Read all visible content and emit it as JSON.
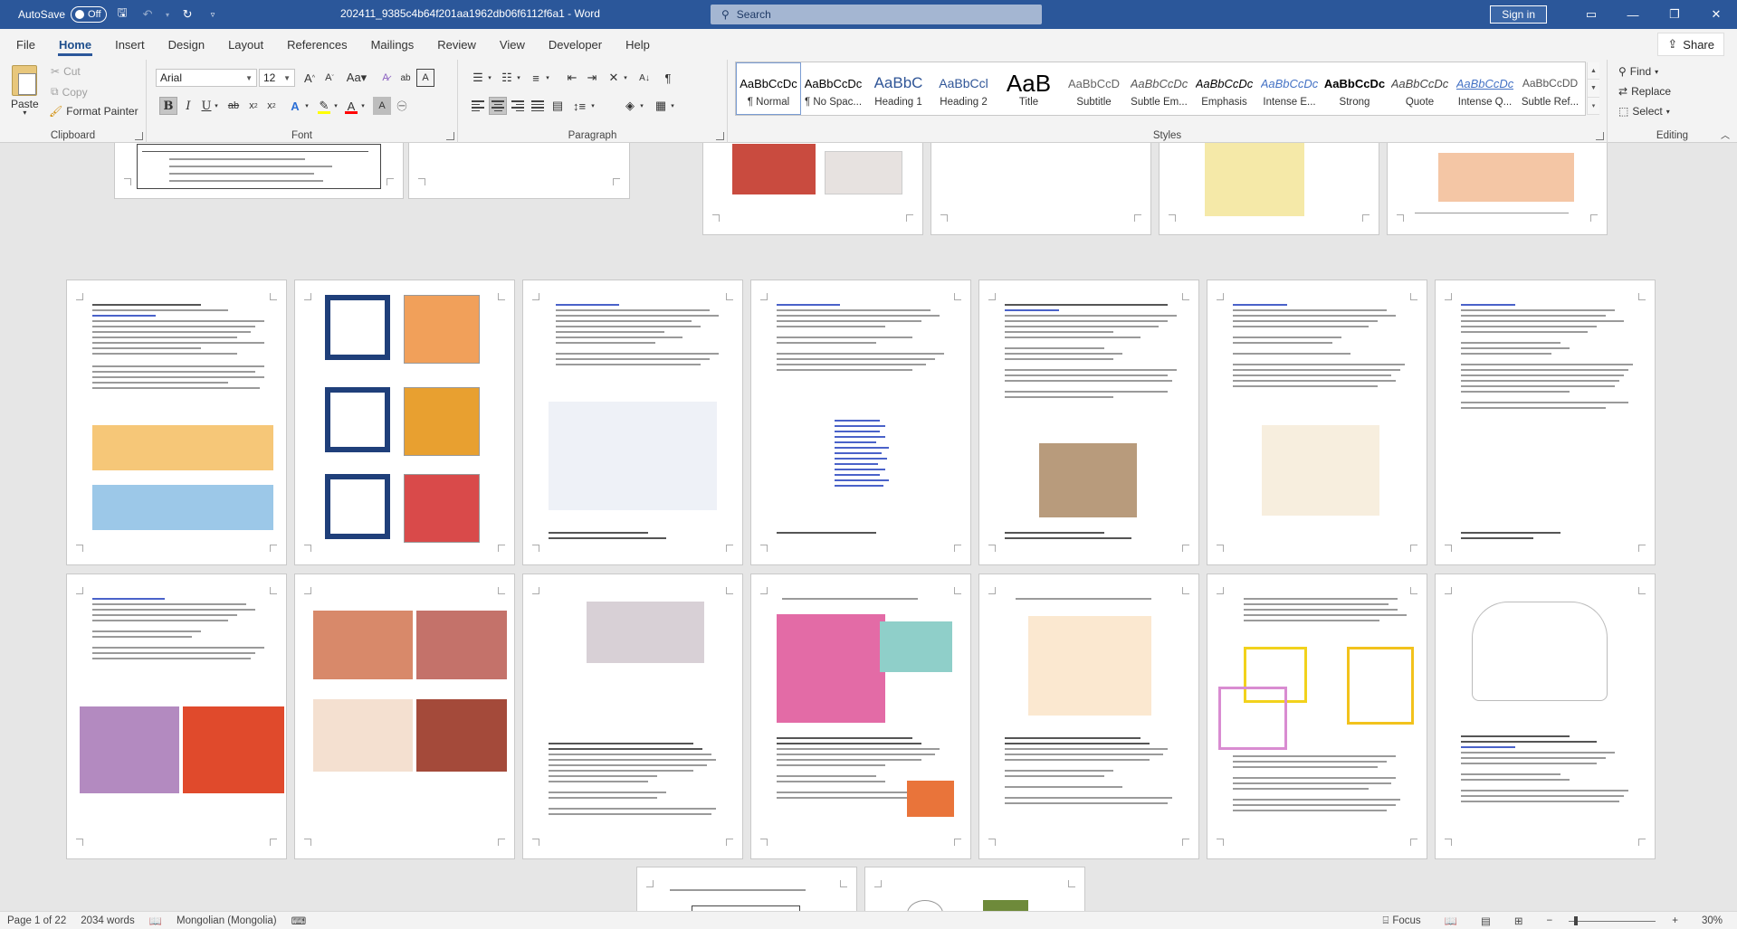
{
  "titlebar": {
    "autosave_label": "AutoSave",
    "autosave_state": "Off",
    "doc_title": "202411_9385c4b64f201aa1962db06f6112f6a1 - Word",
    "search_placeholder": "Search",
    "signin_label": "Sign in"
  },
  "menu": {
    "tabs": [
      "File",
      "Home",
      "Insert",
      "Design",
      "Layout",
      "References",
      "Mailings",
      "Review",
      "View",
      "Developer",
      "Help"
    ],
    "active_tab": "Home",
    "share_label": "Share"
  },
  "ribbon": {
    "clipboard": {
      "label": "Clipboard",
      "paste": "Paste",
      "cut": "Cut",
      "copy": "Copy",
      "format_painter": "Format Painter"
    },
    "font": {
      "label": "Font",
      "font_name": "Arial",
      "font_size": "12"
    },
    "paragraph": {
      "label": "Paragraph"
    },
    "styles": {
      "label": "Styles",
      "items": [
        {
          "preview": "AaBbCcDc",
          "name": "¶ Normal"
        },
        {
          "preview": "AaBbCcDc",
          "name": "¶ No Spac..."
        },
        {
          "preview": "AaBbC",
          "name": "Heading 1"
        },
        {
          "preview": "AaBbCcl",
          "name": "Heading 2"
        },
        {
          "preview": "AaB",
          "name": "Title"
        },
        {
          "preview": "AaBbCcD",
          "name": "Subtitle"
        },
        {
          "preview": "AaBbCcDc",
          "name": "Subtle Em..."
        },
        {
          "preview": "AaBbCcDc",
          "name": "Emphasis"
        },
        {
          "preview": "AaBbCcDc",
          "name": "Intense E..."
        },
        {
          "preview": "AaBbCcDc",
          "name": "Strong"
        },
        {
          "preview": "AaBbCcDc",
          "name": "Quote"
        },
        {
          "preview": "AaBbCcDc",
          "name": "Intense Q..."
        },
        {
          "preview": "AaBbCcDD",
          "name": "Subtle Ref..."
        }
      ]
    },
    "editing": {
      "label": "Editing",
      "find": "Find",
      "replace": "Replace",
      "select": "Select"
    }
  },
  "status": {
    "page": "Page 1 of 22",
    "words": "2034 words",
    "language": "Mongolian (Mongolia)",
    "focus": "Focus",
    "zoom": "30%"
  },
  "colors": {
    "titlebar": "#2b579a",
    "accent_blue": "#2b579a",
    "highlight_yellow": "#ffff00",
    "font_red": "#ff0000"
  }
}
